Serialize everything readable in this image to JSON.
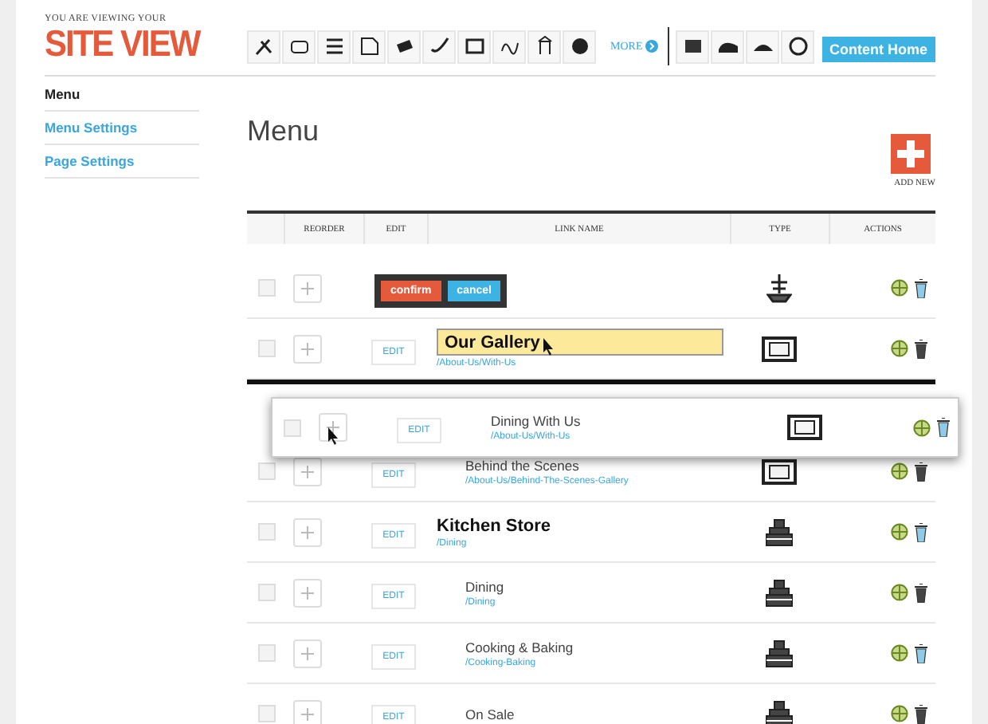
{
  "header": {
    "tagline": "YOU ARE VIEWING YOUR",
    "logo": "SITE VIEW",
    "more_label": "MORE",
    "content_home": "Content Home"
  },
  "sidebar": {
    "items": [
      {
        "label": "Menu",
        "selected": true
      },
      {
        "label": "Menu Settings",
        "selected": false
      },
      {
        "label": "Page Settings",
        "selected": false
      }
    ]
  },
  "page": {
    "title": "Menu",
    "add_label": "ADD NEW"
  },
  "table": {
    "columns": [
      "REORDER",
      "EDIT",
      "LINK NAME",
      "TYPE",
      "ACTIONS"
    ],
    "rows": [
      {
        "edit_label": "",
        "kind": "ship",
        "checked": false,
        "popover": {
          "confirm": "confirm",
          "cancel": "cancel"
        }
      },
      {
        "edit_label": "EDIT",
        "kind": "frame",
        "checked": false,
        "editing": true,
        "name": "Our Gallery",
        "url": "/About-Us/With-Us",
        "drop_below": true,
        "children": [
          {
            "edit_label": "EDIT",
            "kind": "frame",
            "checked": false,
            "dragging": true,
            "name": "Dining With Us",
            "url": "/About-Us/With-Us"
          },
          {
            "edit_label": "EDIT",
            "kind": "frame",
            "checked": false,
            "name": "Behind the Scenes",
            "url": "/About-Us/Behind-The-Scenes-Gallery"
          }
        ]
      },
      {
        "edit_label": "EDIT",
        "kind": "store",
        "checked": false,
        "name": "Kitchen Store",
        "url": "/Dining",
        "children": [
          {
            "edit_label": "EDIT",
            "kind": "store",
            "checked": false,
            "name": "Dining",
            "url": "/Dining"
          },
          {
            "edit_label": "EDIT",
            "kind": "store",
            "checked": false,
            "name": "Cooking & Baking",
            "url": "/Cooking-Baking"
          },
          {
            "edit_label": "EDIT",
            "kind": "store",
            "checked": false,
            "name": "On Sale"
          }
        ]
      }
    ]
  }
}
